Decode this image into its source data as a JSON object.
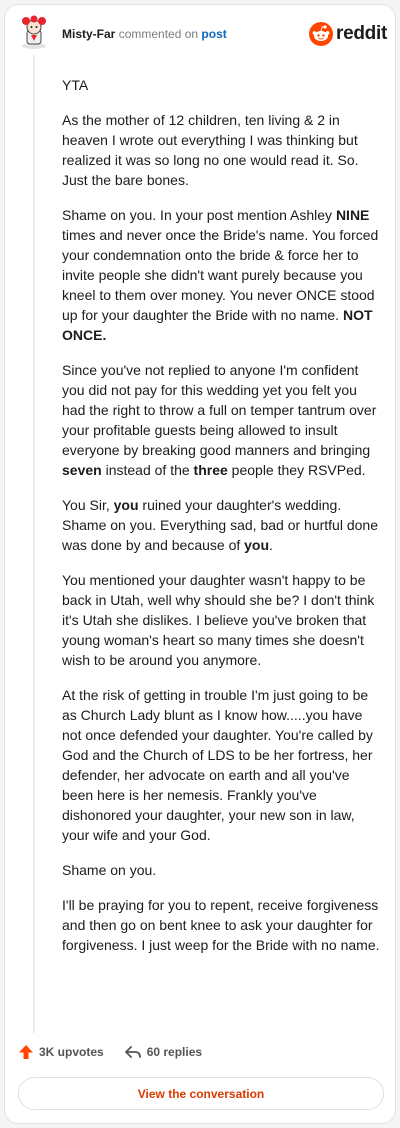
{
  "header": {
    "username": "Misty-Far",
    "commented_text": "commented on",
    "post_link": "post",
    "brand": "reddit",
    "brand_color": "#ff4500"
  },
  "comment": {
    "p1": "YTA",
    "p2": "As the mother of 12 children, ten living & 2 in heaven I wrote out everything I was thinking but realized it was so long no one would read it. So. Just the bare bones.",
    "p3a": "Shame on you. In your post mention Ashley ",
    "p3b": "NINE",
    "p3c": " times and never once the Bride's name. You forced your condemnation onto the bride & force her to invite people she didn't want purely because you kneel to them over money. You never ONCE stood up for your daughter the Bride with no name. ",
    "p3d": "NOT ONCE.",
    "p4a": "Since you've not replied to anyone I'm confident you did not pay for this wedding yet you felt you had the right to throw a full on temper tantrum over your profitable guests being allowed to insult everyone by breaking good manners and bringing ",
    "p4b": "seven",
    "p4c": " instead of the ",
    "p4d": "three",
    "p4e": " people they RSVPed.",
    "p5a": "You Sir, ",
    "p5b": "you",
    "p5c": " ruined your daughter's wedding. Shame on you. Everything sad, bad or hurtful done was done by and because of ",
    "p5d": "you",
    "p5e": ".",
    "p6": "You mentioned your daughter wasn't happy to be back in Utah, well why should she be? I don't think it's Utah she dislikes. I believe you've broken that young woman's heart so many times she doesn't wish to be around you anymore.",
    "p7": "At the risk of getting in trouble I'm just going to be as Church Lady blunt as I know how.....you have not once defended your daughter. You're called by God and the Church of LDS to be her fortress, her defender, her advocate on earth and all you've been here is her nemesis. Frankly you've dishonored your daughter, your new son in law, your wife and your God.",
    "p8": "Shame on you.",
    "p9": "I'll be praying for you to repent, receive forgiveness and then go on bent knee to ask your daughter for forgiveness. I just weep for the Bride with no name."
  },
  "footer": {
    "upvotes": "3K upvotes",
    "replies": "60 replies",
    "upvote_icon": "upvote-arrow-icon",
    "reply_icon": "reply-arrow-icon",
    "view_button": "View the conversation",
    "accent_color": "#d93a00"
  }
}
